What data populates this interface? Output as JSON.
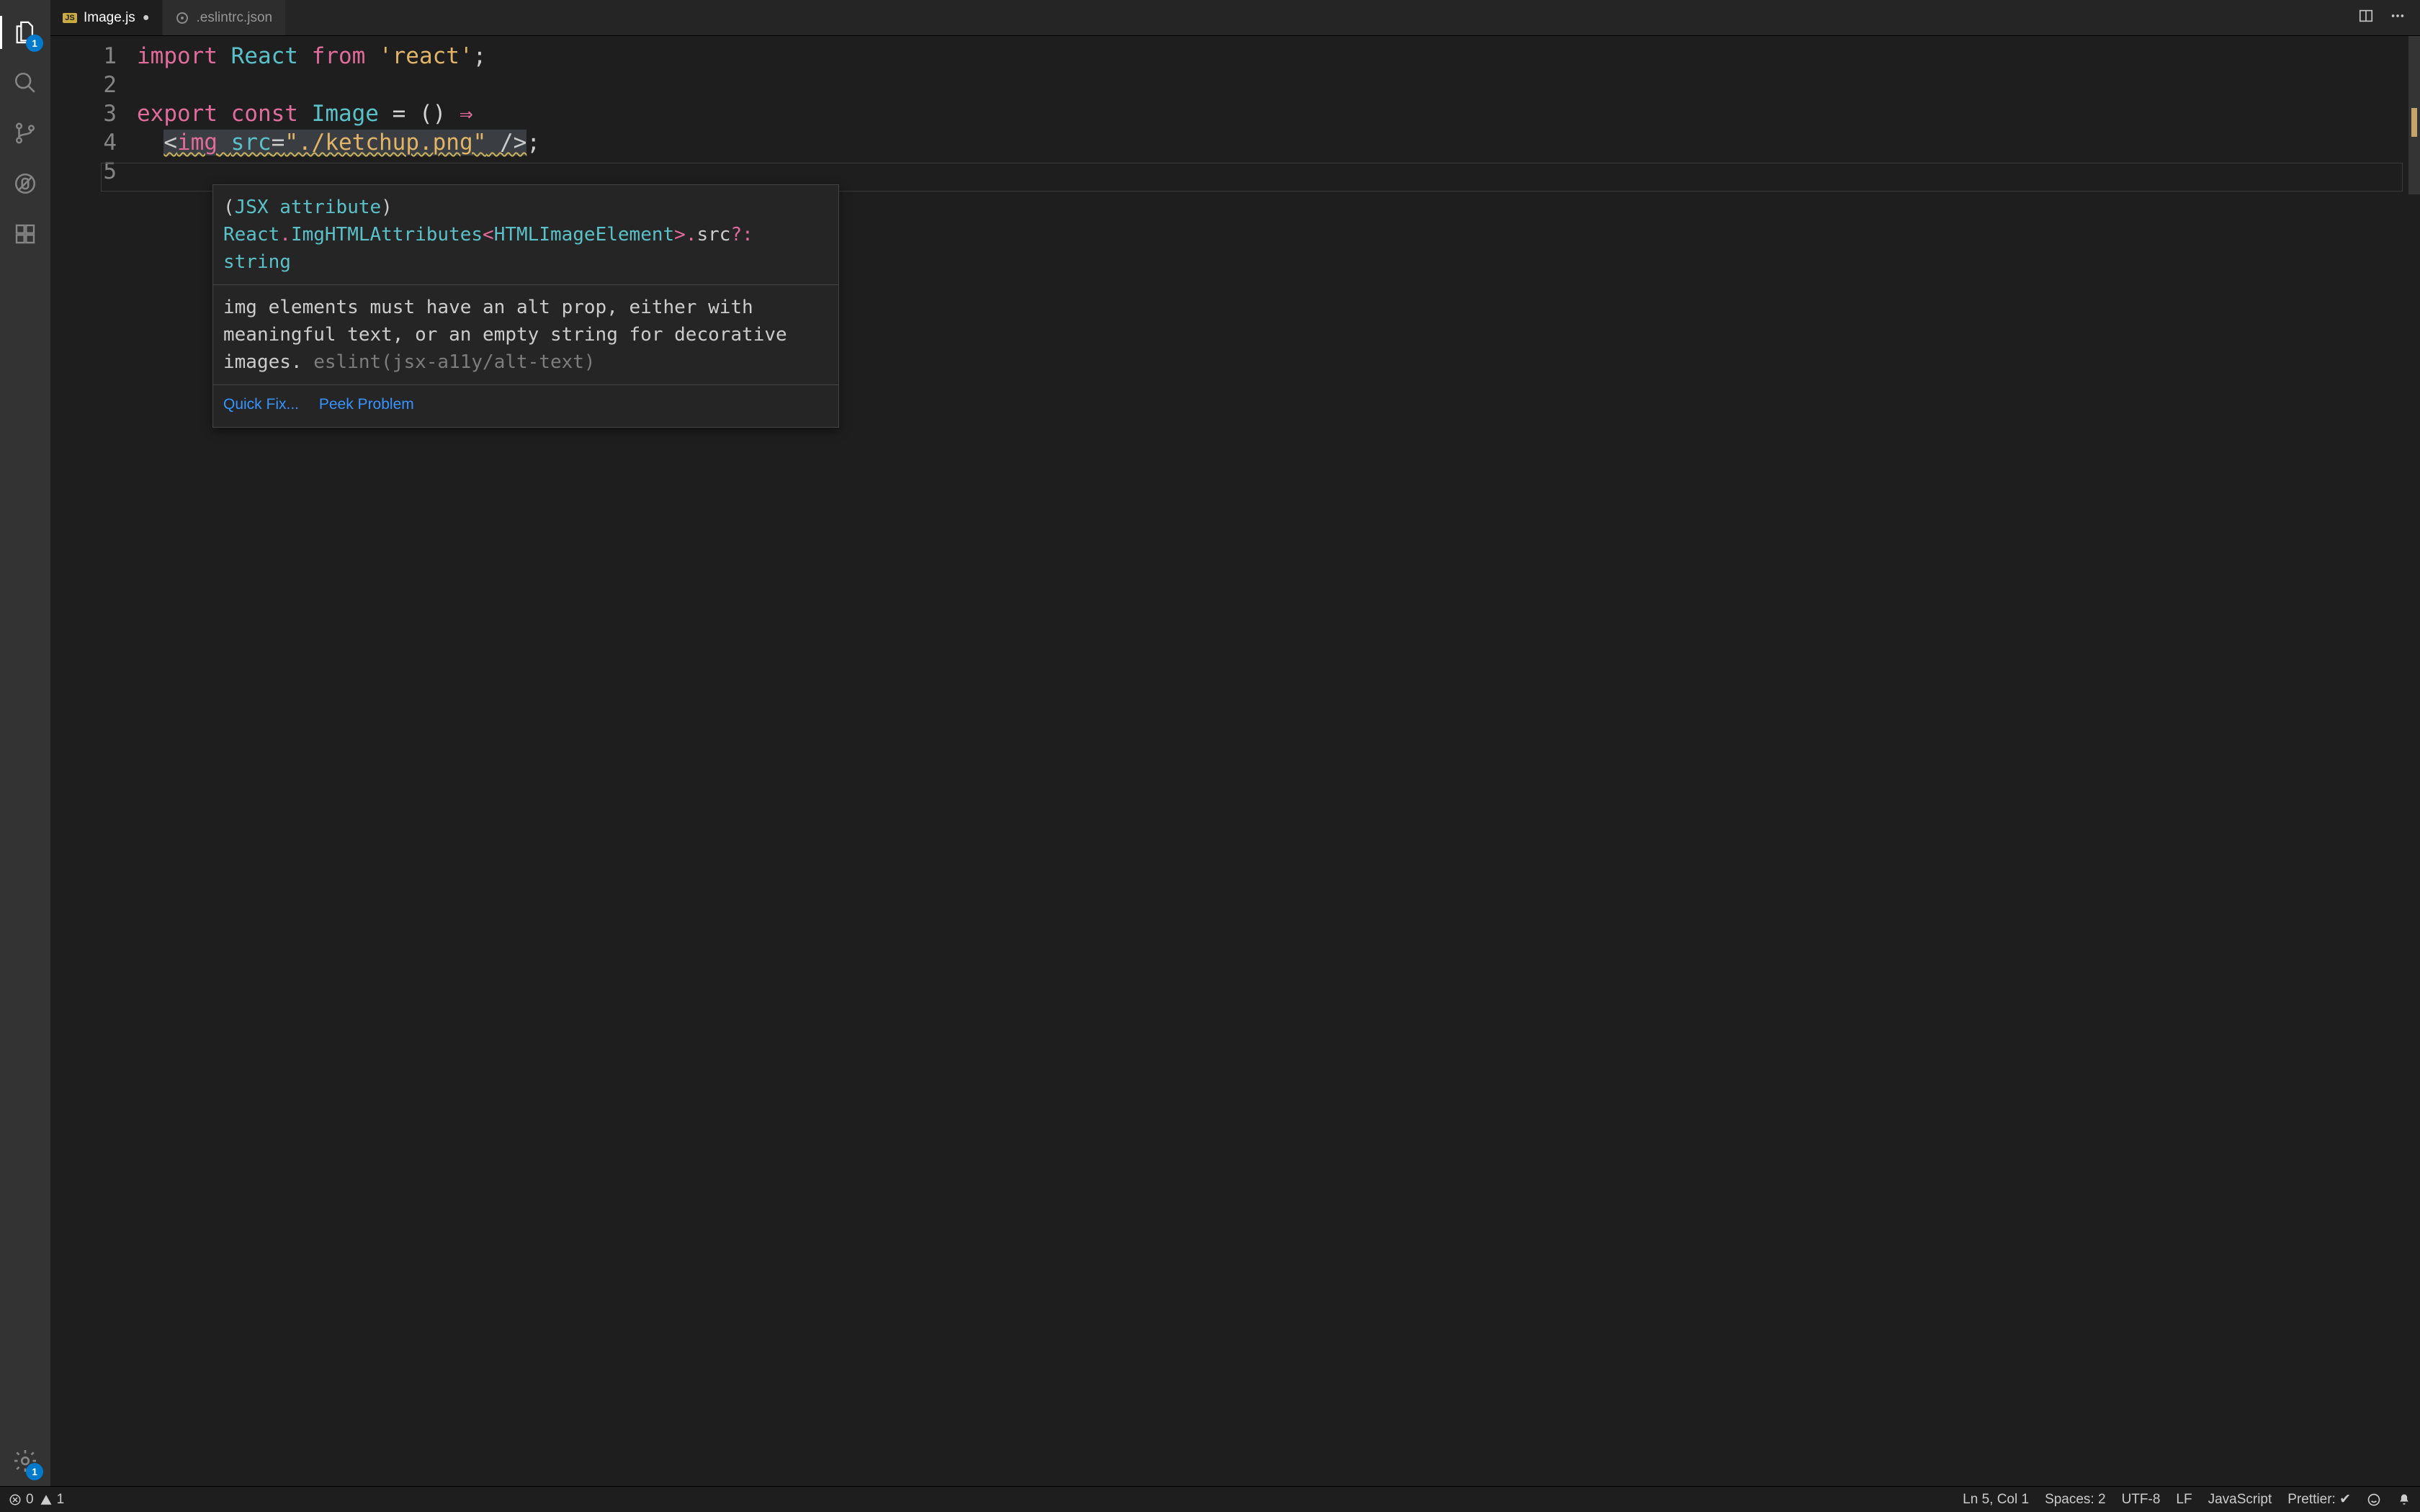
{
  "tabs": [
    {
      "label": "Image.js",
      "icon": "js",
      "dirty": true,
      "active": true
    },
    {
      "label": ".eslintrc.json",
      "icon": "eslint",
      "dirty": false,
      "active": false
    }
  ],
  "activity": {
    "explorer_badge": "1",
    "settings_badge": "1"
  },
  "gutter_lines": [
    "1",
    "2",
    "3",
    "4",
    "5"
  ],
  "code": {
    "l1_import": "import",
    "l1_react": "React",
    "l1_from": "from",
    "l1_str": "'react'",
    "l1_semi": ";",
    "l3_export": "export",
    "l3_const": "const",
    "l3_name": "Image",
    "l3_eq": " = () ",
    "l3_arrow": "⇒",
    "l4_indent": "  ",
    "l4_open": "<",
    "l4_tag": "img",
    "l4_sp": " ",
    "l4_attr": "src",
    "l4_eq": "=",
    "l4_str": "\"./ketchup.png\"",
    "l4_close": " />",
    "l4_semi": ";"
  },
  "hover": {
    "sig_open": "(",
    "sig_jsx": "JSX attribute",
    "sig_close": ") ",
    "sig_react": "React",
    "sig_dot1": ".",
    "sig_type1": "ImgHTMLAttributes",
    "sig_lt": "<",
    "sig_type2": "HTMLImageElement",
    "sig_gt": ">",
    "sig_dot2": ".",
    "sig_src": "src",
    "sig_opt": "?:",
    "sig_sp": " ",
    "sig_str": "string",
    "message": "img elements must have an alt prop, either with meaningful text, or an empty string for decorative images.",
    "rule": "eslint(jsx-a11y/alt-text)",
    "action_quickfix": "Quick Fix...",
    "action_peek": "Peek Problem"
  },
  "status": {
    "errors": "0",
    "warnings": "1",
    "cursor": "Ln 5, Col 1",
    "spaces": "Spaces: 2",
    "encoding": "UTF-8",
    "eol": "LF",
    "lang": "JavaScript",
    "prettier": "Prettier: ✔"
  }
}
